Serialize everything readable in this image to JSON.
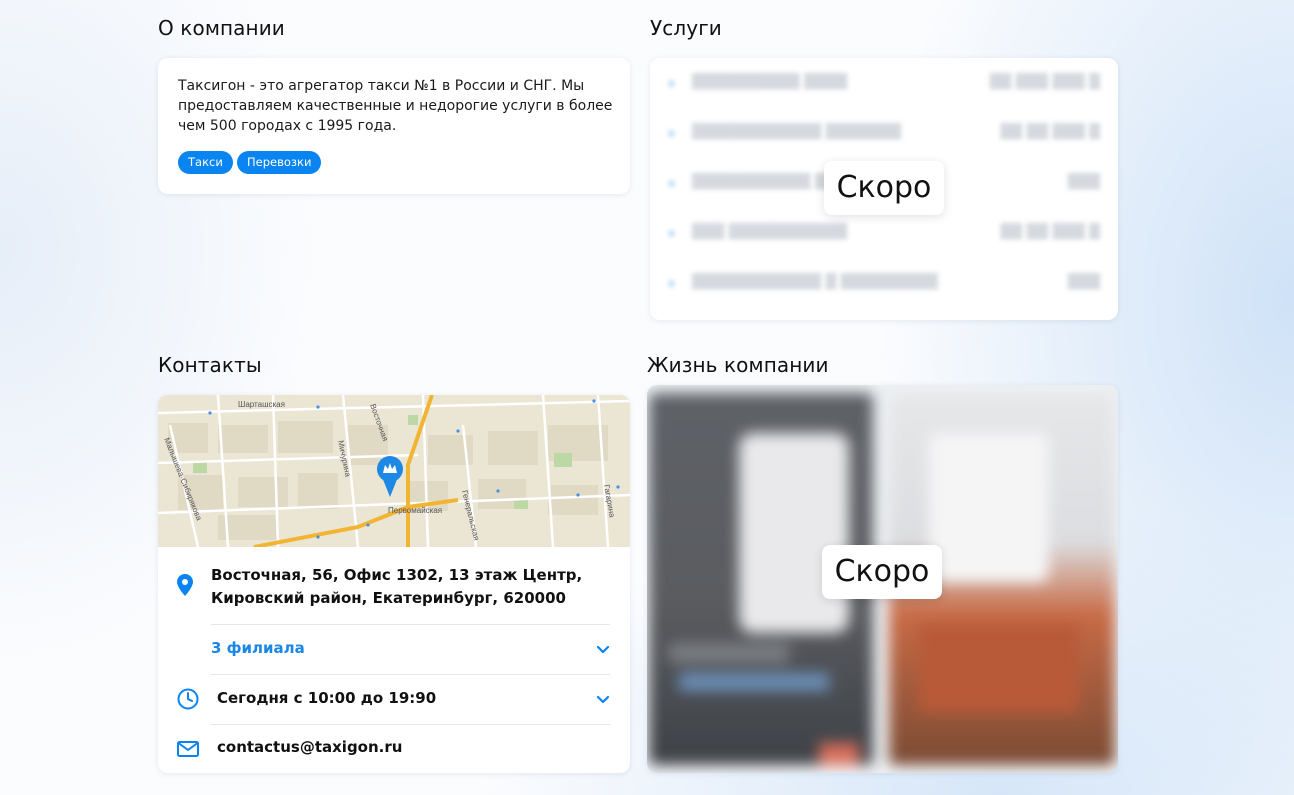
{
  "about": {
    "title": "О компании",
    "text": "Таксигон - это агрегатор такси №1 в России и СНГ. Мы предоставляем качественные и недорогие услуги в более чем 500 городах с 1995 года.",
    "tags": [
      "Такси",
      "Перевозки"
    ]
  },
  "services": {
    "title": "Услуги",
    "soon_label": "Скоро"
  },
  "contacts": {
    "title": "Контакты",
    "map": {
      "streets": [
        "Шарташская",
        "Восточная",
        "Мичурина",
        "Малышева-Сибирякова",
        "Первомайская",
        "Генеральская",
        "Гагарина"
      ]
    },
    "address": "Восточная, 56, Офис 1302, 13 этаж Центр, Кировский район, Екатеринбург, 620000",
    "branches_link": "3 филиала",
    "hours": "Сегодня с 10:00 до 19:90",
    "email": "contactus@taxigon.ru"
  },
  "life": {
    "title": "Жизнь компании",
    "soon_label": "Скоро"
  },
  "colors": {
    "accent": "#0a84f0",
    "link": "#1a86e6"
  },
  "icons": [
    "location-pin-icon",
    "clock-icon",
    "mail-icon",
    "chevron-down-icon",
    "map-marker-icon"
  ]
}
